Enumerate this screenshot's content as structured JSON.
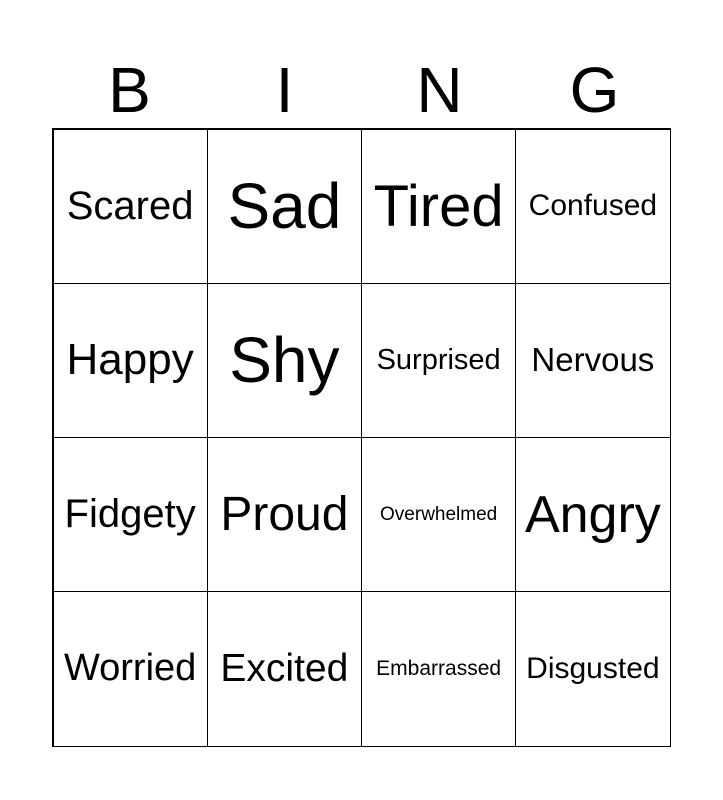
{
  "header": {
    "letters": [
      "B",
      "I",
      "N",
      "G"
    ]
  },
  "cells": [
    {
      "text": "Scared",
      "size": 40
    },
    {
      "text": "Sad",
      "size": 64
    },
    {
      "text": "Tired",
      "size": 58
    },
    {
      "text": "Confused",
      "size": 30
    },
    {
      "text": "Happy",
      "size": 44
    },
    {
      "text": "Shy",
      "size": 64
    },
    {
      "text": "Surprised",
      "size": 29
    },
    {
      "text": "Nervous",
      "size": 33
    },
    {
      "text": "Fidgety",
      "size": 40
    },
    {
      "text": "Proud",
      "size": 48
    },
    {
      "text": "Overwhelmed",
      "size": 19
    },
    {
      "text": "Angry",
      "size": 52
    },
    {
      "text": "Worried",
      "size": 38
    },
    {
      "text": "Excited",
      "size": 39
    },
    {
      "text": "Embarrassed",
      "size": 21
    },
    {
      "text": "Disgusted",
      "size": 30
    }
  ]
}
